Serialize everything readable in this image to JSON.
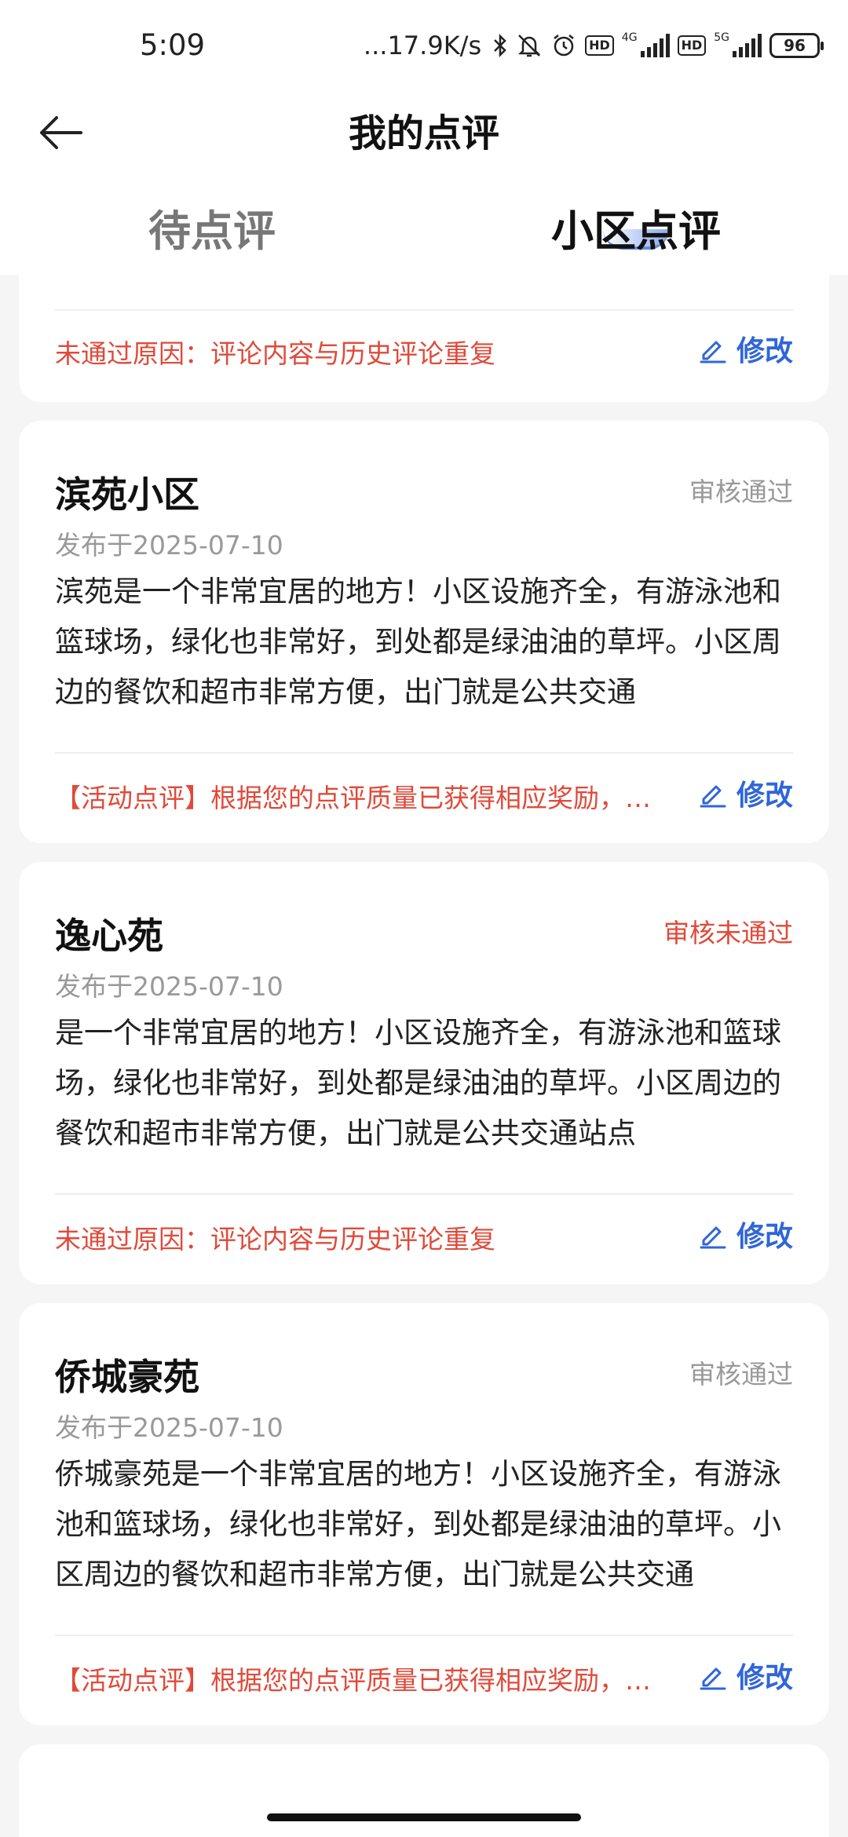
{
  "status_bar": {
    "time": "5:09",
    "speed": "...17.9K/s",
    "hd1": "HD",
    "net1": "4G",
    "hd2": "HD",
    "net2": "5G",
    "battery": "96"
  },
  "header": {
    "title": "我的点评"
  },
  "tabs": [
    {
      "label": "待点评",
      "active": false
    },
    {
      "label": "小区点评",
      "active": true
    }
  ],
  "partial_card": {
    "note": "未通过原因：评论内容与历史评论重复",
    "edit_label": "修改"
  },
  "reviews": [
    {
      "name": "滨苑小区",
      "status": "审核通过",
      "date": "发布于2025-07-10",
      "body": "滨苑是一个非常宜居的地方！小区设施齐全，有游泳池和篮球场，绿化也非常好，到处都是绿油油的草坪。小区周边的餐饮和超市非常方便，出门就是公共交通",
      "note": "【活动点评】根据您的点评质量已获得相应奖励，具体奖励请查看",
      "edit_label": "修改"
    },
    {
      "name": "逸心苑",
      "status": "审核未通过",
      "date": "发布于2025-07-10",
      "body": "是一个非常宜居的地方！小区设施齐全，有游泳池和篮球场，绿化也非常好，到处都是绿油油的草坪。小区周边的餐饮和超市非常方便，出门就是公共交通站点",
      "note": "未通过原因：评论内容与历史评论重复",
      "edit_label": "修改"
    },
    {
      "name": "侨城豪苑",
      "status": "审核通过",
      "date": "发布于2025-07-10",
      "body": "侨城豪苑是一个非常宜居的地方！小区设施齐全，有游泳池和篮球场，绿化也非常好，到处都是绿油油的草坪。小区周边的餐饮和超市非常方便，出门就是公共交通",
      "note": "【活动点评】根据您的点评质量已获得相应奖励，具体奖励请查看",
      "edit_label": "修改"
    }
  ],
  "colors": {
    "accent": "#2f66d8",
    "fail": "#e04a3a",
    "muted": "#999999"
  }
}
